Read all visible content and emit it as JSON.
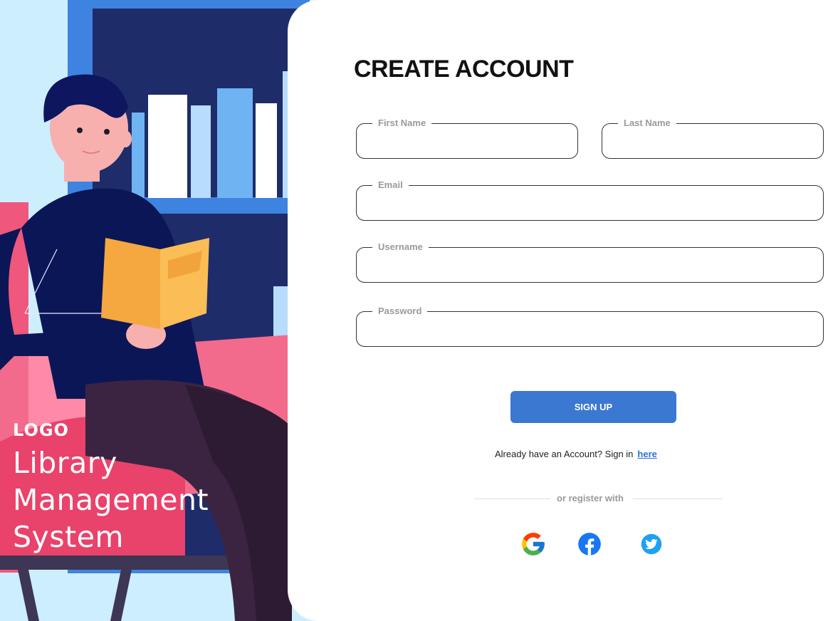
{
  "brand": {
    "logo": "LOGO",
    "app_title": "Library\nManagement\nSystem"
  },
  "form": {
    "heading": "CREATE ACCOUNT",
    "fields": {
      "first_name": {
        "label": "First Name",
        "value": ""
      },
      "last_name": {
        "label": "Last Name",
        "value": ""
      },
      "email": {
        "label": "Email",
        "value": ""
      },
      "username": {
        "label": "Username",
        "value": ""
      },
      "password": {
        "label": "Password",
        "value": ""
      }
    },
    "signup_label": "SIGN UP",
    "signin_prompt": "Already have an Account? Sign in",
    "signin_link": "here",
    "divider_text": "or register with"
  },
  "social": [
    {
      "name": "google-icon",
      "color": "#4285F4"
    },
    {
      "name": "facebook-icon",
      "color": "#1877F2"
    },
    {
      "name": "twitter-icon",
      "color": "#1DA1F2"
    }
  ],
  "colors": {
    "accent": "#3a78d1",
    "link": "#2c6fd6",
    "illustration_chair": "#f0577d",
    "illustration_shelf": "#1f2d6b"
  }
}
